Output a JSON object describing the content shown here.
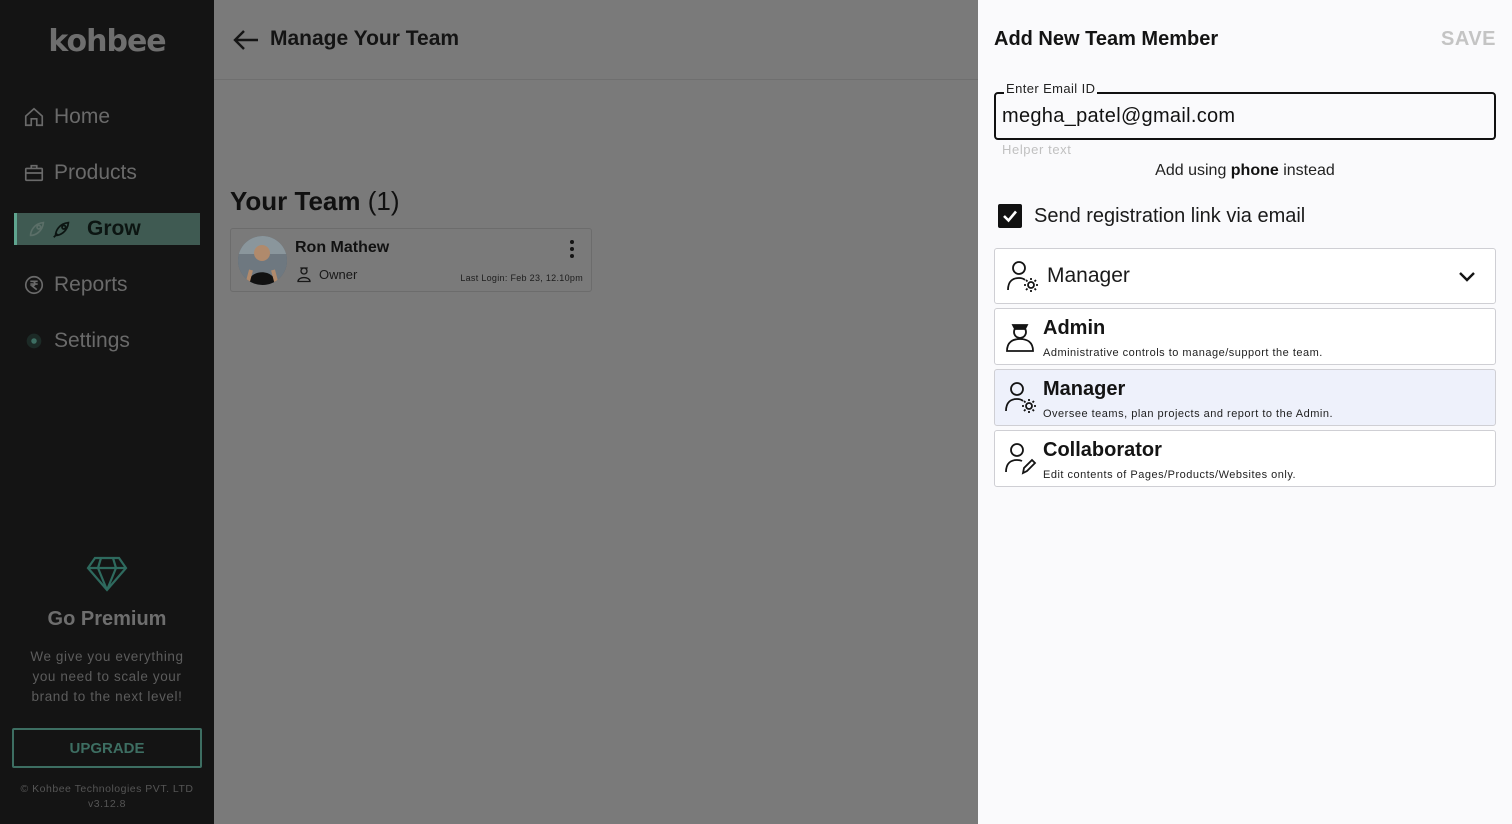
{
  "app": {
    "logo": "kohbee"
  },
  "sidebar": {
    "items": [
      {
        "label": "Home",
        "icon": "home-icon"
      },
      {
        "label": "Products",
        "icon": "briefcase-icon"
      },
      {
        "label": "Grow",
        "icon": "rocket-icon",
        "active": true
      },
      {
        "label": "Reports",
        "icon": "rupee-icon"
      },
      {
        "label": "Settings",
        "icon": "settings-icon"
      }
    ],
    "premium": {
      "title": "Go Premium",
      "description": "We give you everything you need to scale your brand to the next level!",
      "upgrade_label": "UPGRADE"
    },
    "copyright": "© Kohbee Technologies PVT. LTD",
    "version": "v3.12.8"
  },
  "main": {
    "title": "Manage Your Team",
    "team_heading": "Your Team",
    "team_count": "(1)",
    "members": [
      {
        "name": "Ron Mathew",
        "role": "Owner",
        "last_login": "Last Login: Feb 23, 12.10pm"
      }
    ]
  },
  "panel": {
    "title": "Add New Team Member",
    "save_label": "SAVE",
    "email_label": "Enter Email ID",
    "email_value": "megha_patel@gmail.com",
    "helper_text": "Helper text",
    "alt_prefix": "Add using ",
    "alt_bold": "phone",
    "alt_suffix": " instead",
    "send_link_label": "Send registration link via email",
    "send_link_checked": true,
    "role_selected": "Manager",
    "roles": [
      {
        "name": "Admin",
        "description": "Administrative controls to manage/support the team.",
        "icon": "admin-user-icon"
      },
      {
        "name": "Manager",
        "description": "Oversee teams, plan projects and report to the Admin.",
        "icon": "manager-user-gear-icon",
        "selected": true
      },
      {
        "name": "Collaborator",
        "description": "Edit contents of Pages/Products/Websites only.",
        "icon": "collaborator-user-pen-icon"
      }
    ]
  },
  "colors": {
    "sidebar_bg": "#141414",
    "active_bg": "#3f5a52",
    "accent": "#3d6e62",
    "overlay": "#7a7a7a",
    "panel_bg": "#fafafc",
    "selected_option_bg": "#eef1fb"
  }
}
